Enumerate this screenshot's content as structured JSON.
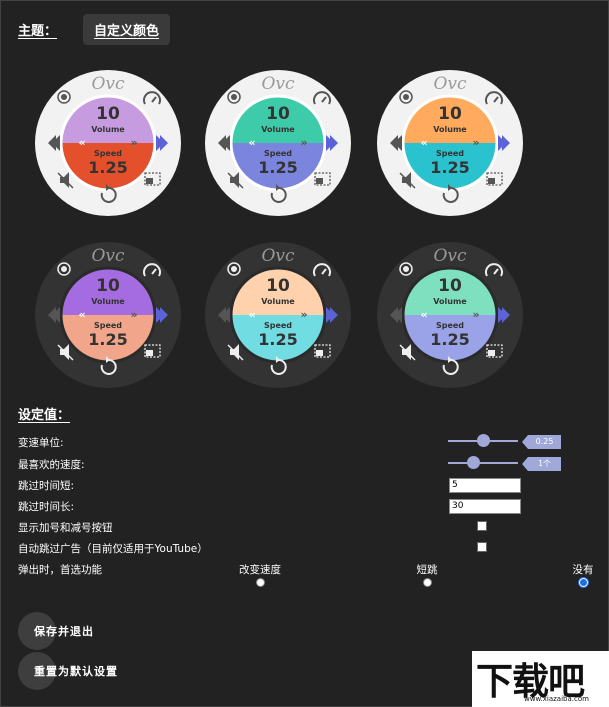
{
  "header": {
    "theme_label": "主题：",
    "theme_button": "自定义颜色"
  },
  "colors": {
    "accent": "#9fa8d8",
    "arrow_left": "#555555",
    "arrow_right": "#5b63d6"
  },
  "dials": [
    {
      "logo": "Ovc",
      "volume": "10",
      "volume_label": "Volume",
      "speed_label": "Speed",
      "speed": "1.25",
      "bg": "#f2f2f2",
      "ring": "#ffffff",
      "top": "#c79be0",
      "bottom": "#e5502c",
      "fg": "#555555"
    },
    {
      "logo": "Ovc",
      "volume": "10",
      "volume_label": "Volume",
      "speed_label": "Speed",
      "speed": "1.25",
      "bg": "#f2f2f2",
      "ring": "#ffffff",
      "top": "#3ecba9",
      "bottom": "#7b85de",
      "fg": "#555555"
    },
    {
      "logo": "Ovc",
      "volume": "10",
      "volume_label": "Volume",
      "speed_label": "Speed",
      "speed": "1.25",
      "bg": "#f2f2f2",
      "ring": "#ffffff",
      "top": "#ffaa5c",
      "bottom": "#2bc2cf",
      "fg": "#555555"
    },
    {
      "logo": "Ovc",
      "volume": "10",
      "volume_label": "Volume",
      "speed_label": "Speed",
      "speed": "1.25",
      "bg": "#333333",
      "ring": "#2a2a2a",
      "top": "#a56be0",
      "bottom": "#f1a68b",
      "fg": "#eeeeee"
    },
    {
      "logo": "Ovc",
      "volume": "10",
      "volume_label": "Volume",
      "speed_label": "Speed",
      "speed": "1.25",
      "bg": "#333333",
      "ring": "#2a2a2a",
      "top": "#ffd2ad",
      "bottom": "#71dde3",
      "fg": "#eeeeee"
    },
    {
      "logo": "Ovc",
      "volume": "10",
      "volume_label": "Volume",
      "speed_label": "Speed",
      "speed": "1.25",
      "bg": "#333333",
      "ring": "#2a2a2a",
      "top": "#7fe0c0",
      "bottom": "#9aa3e8",
      "fg": "#eeeeee"
    }
  ],
  "settings": {
    "title": "设定值：",
    "speed_unit": {
      "label": "变速单位:",
      "value": "0.25",
      "fraction": 0.5
    },
    "favorite_speed": {
      "label": "最喜欢的速度:",
      "value": "1个",
      "fraction": 0.35
    },
    "skip_short": {
      "label": "跳过时间短:",
      "value": "5"
    },
    "skip_long": {
      "label": "跳过时间长:",
      "value": "30"
    },
    "show_plus_minus": {
      "label": "显示加号和减号按钮"
    },
    "auto_skip_ads": {
      "label": "自动跳过广告（目前仅适用于YouTube）"
    },
    "popup": {
      "label": "弹出时，首选功能",
      "options": [
        "改变速度",
        "短跳",
        "没有"
      ],
      "selected": 2
    }
  },
  "buttons": {
    "save": "保存并退出",
    "reset": "重置为默认设置"
  },
  "watermark": {
    "text": "下载吧",
    "url": "www.xiazaiba.com"
  }
}
